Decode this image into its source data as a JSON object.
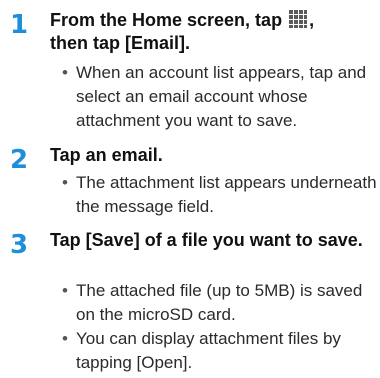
{
  "steps": [
    {
      "number": "1",
      "title_before_icon": "From the Home screen, tap ",
      "title_after_icon": ",",
      "title_line2": "then tap [Email].",
      "bullets": [
        "When an account list appears, tap and select an email account whose attachment you want to save."
      ]
    },
    {
      "number": "2",
      "title": "Tap an email.",
      "bullets": [
        "The attachment list appears underneath the message field."
      ]
    },
    {
      "number": "3",
      "title": "Tap [Save] of a file you want to save.",
      "bullets": [
        "The attached file (up to 5MB) is saved on the microSD card.",
        "You can display attachment files by tapping [Open]."
      ]
    }
  ],
  "bullet_marker": "•",
  "icons": {
    "apps_grid": "apps-grid-icon"
  },
  "colors": {
    "step_number": "#1d8fd8",
    "icon_fill": "#5a5a5a"
  }
}
